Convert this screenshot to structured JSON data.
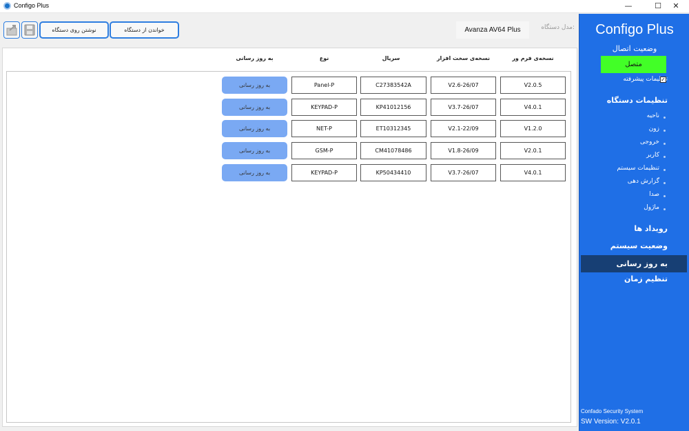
{
  "window": {
    "title": "Configo Plus",
    "minimize": "—",
    "maximize": "☐",
    "close": "✕"
  },
  "toolbar": {
    "write_label": "نوشتن روی دستگاه",
    "read_label": "خواندن از دستگاه",
    "device_name": "Avanza AV64 Plus",
    "device_label": "مدل دستگاه:"
  },
  "table": {
    "headers": {
      "firmware": "نسخه‌ی فرم ور",
      "hardware": "نسخه‌ی سخت افزار",
      "serial": "سریال",
      "type": "نوع",
      "update": "به روز رسانی"
    },
    "rows": [
      {
        "firmware": "V2.0.5",
        "hardware": "V2.6-26/07",
        "serial": "C27383542A",
        "type": "Panel-P",
        "update": "به روز رسانی"
      },
      {
        "firmware": "V4.0.1",
        "hardware": "V3.7-26/07",
        "serial": "KP41012156",
        "type": "KEYPAD-P",
        "update": "به روز رسانی"
      },
      {
        "firmware": "V1.2.0",
        "hardware": "V2.1-22/09",
        "serial": "ET10312345",
        "type": "NET-P",
        "update": "به روز رسانی"
      },
      {
        "firmware": "V2.0.1",
        "hardware": "V1.8-26/09",
        "serial": "CM41078486",
        "type": "GSM-P",
        "update": "به روز رسانی"
      },
      {
        "firmware": "V4.0.1",
        "hardware": "V3.7-26/07",
        "serial": "KP50434410",
        "type": "KEYPAD-P",
        "update": "به روز رسانی"
      }
    ]
  },
  "sidebar": {
    "brand": "Configo Plus",
    "connection_title": "وضعیت اتصال",
    "connection_status": "متصل",
    "advanced_settings": "تنظیمات پیشرفته",
    "device_settings": "تنظیمات دستگاه",
    "sub_items": [
      "ناحیه",
      "زون",
      "خروجی",
      "کاربر",
      "تنظیمات سیستم",
      "گزارش دهی",
      "صدا",
      "ماژول"
    ],
    "events": "رویداد ها",
    "system_status": "وضعیت سیستم",
    "update": "به روز رسانی",
    "time_settings": "تنظیم زمان",
    "company": "Confado Security System",
    "version": "SW Version: V2.0.1"
  },
  "colors": {
    "sidebar_bg": "#1f6fe6",
    "active_item_bg": "#173f74",
    "connected_green": "#42ff27",
    "update_button": "#7aa9f3",
    "button_border": "#2d7de0"
  }
}
